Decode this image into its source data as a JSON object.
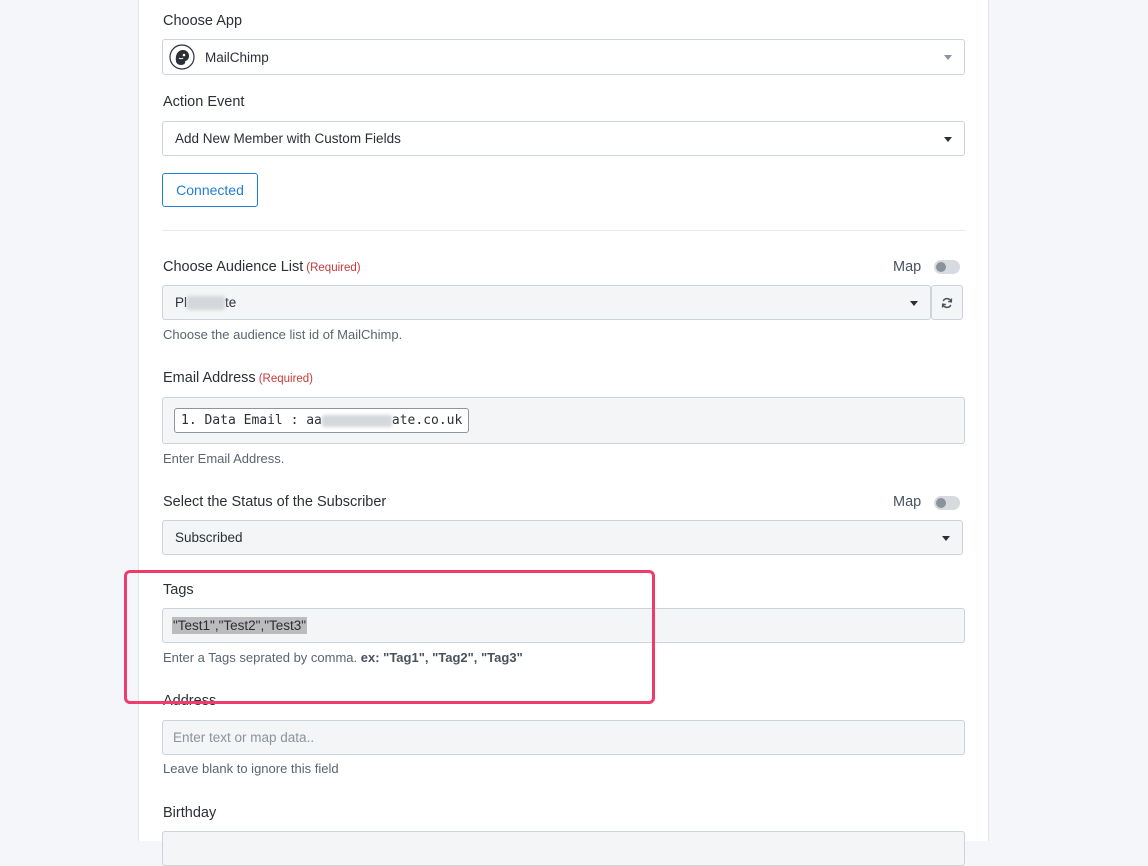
{
  "choose_app": {
    "label": "Choose App",
    "selected": "MailChimp",
    "logo_icon": "mailchimp-logo"
  },
  "action_event": {
    "label": "Action Event",
    "selected": "Add New Member with Custom Fields"
  },
  "connected_button": {
    "label": "Connected"
  },
  "audience_list": {
    "label": "Choose Audience List",
    "required": "(Required)",
    "map_label": "Map",
    "value_start": "Pl",
    "value_end": "te",
    "help": "Choose the audience list id of MailChimp."
  },
  "email_address": {
    "label": "Email Address",
    "required": "(Required)",
    "chip_prefix": "1. Data Email : aa",
    "chip_suffix": "ate.co.uk",
    "help": "Enter Email Address."
  },
  "subscriber_status": {
    "label": "Select the Status of the Subscriber",
    "map_label": "Map",
    "selected": "Subscribed"
  },
  "tags": {
    "label": "Tags",
    "value": "\"Test1\",\"Test2\",\"Test3\"",
    "help_prefix": "Enter a Tags seprated by comma.",
    "help_example": "ex: \"Tag1\", \"Tag2\", \"Tag3\""
  },
  "address": {
    "label": "Address",
    "placeholder": "Enter text or map data..",
    "help": "Leave blank to ignore this field"
  },
  "birthday": {
    "label": "Birthday"
  },
  "colors": {
    "accent": "#1f7fd6",
    "required": "#c73a3a",
    "highlight": "#ee3c6c"
  }
}
